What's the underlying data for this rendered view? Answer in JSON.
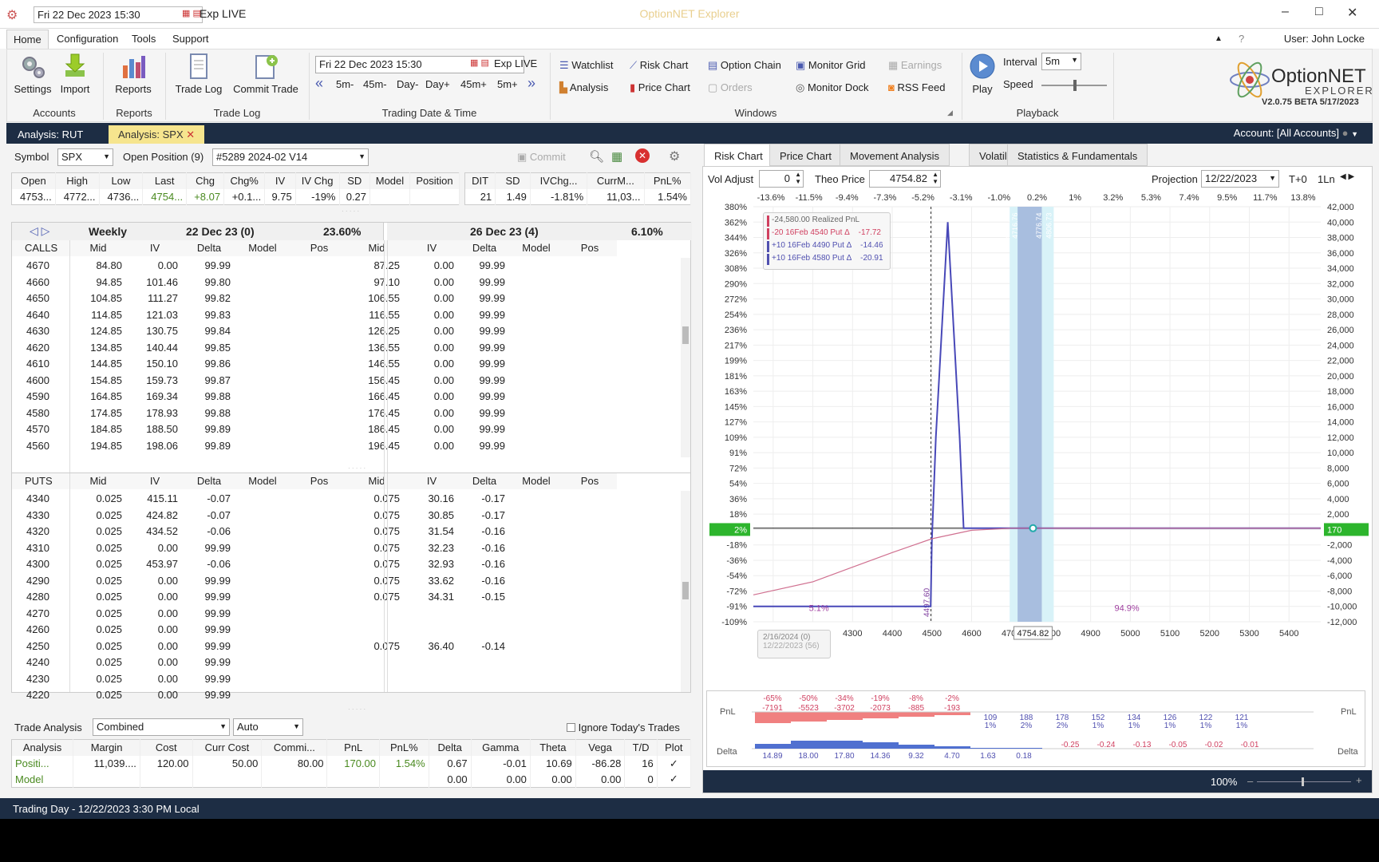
{
  "titlebar": {
    "datetime": "Fri 22 Dec 2023 15:30",
    "exp": "Exp LIVE",
    "app_title": "OptionNET Explorer"
  },
  "menu": {
    "home": "Home",
    "configuration": "Configuration",
    "tools": "Tools",
    "support": "Support",
    "user": "User: John Locke"
  },
  "ribbon": {
    "settings": "Settings",
    "import": "Import",
    "reports": "Reports",
    "trade_log": "Trade Log",
    "commit_trade": "Commit Trade",
    "groups": {
      "accounts": "Accounts",
      "reports": "Reports",
      "trade_log": "Trade Log",
      "trading_date": "Trading Date & Time",
      "windows": "Windows",
      "playback": "Playback"
    },
    "date": "Fri 22 Dec 2023 15:30",
    "exp": "Exp LIVE",
    "steps": [
      "5m-",
      "45m-",
      "Day-",
      "Day+",
      "45m+",
      "5m+"
    ],
    "windows": {
      "watchlist": "Watchlist",
      "risk_chart": "Risk Chart",
      "option_chain": "Option Chain",
      "monitor_grid": "Monitor Grid",
      "earnings": "Earnings",
      "analysis": "Analysis",
      "price_chart": "Price Chart",
      "orders": "Orders",
      "monitor_dock": "Monitor Dock",
      "rss_feed": "RSS Feed"
    },
    "play": "Play",
    "interval_label": "Interval",
    "interval_value": "5m",
    "speed_label": "Speed",
    "logo_line1": "OptionNET",
    "logo_line2": "EXPLORER",
    "version": "V2.0.75 BETA 5/17/2023"
  },
  "doc_tabs": {
    "rut": "Analysis: RUT",
    "spx": "Analysis: SPX",
    "account": "Account: [All Accounts]"
  },
  "left": {
    "symbol_label": "Symbol",
    "symbol": "SPX",
    "open_pos_label": "Open Position (9)",
    "position": "#5289 2024-02 V14",
    "commit": "Commit",
    "quote_headers": [
      "Open",
      "High",
      "Low",
      "Last",
      "Chg",
      "Chg%",
      "IV",
      "IV Chg",
      "SD",
      "Model",
      "Position"
    ],
    "quote_values": [
      "4753...",
      "4772...",
      "4736...",
      "4754...",
      "+8.07",
      "+0.1...",
      "9.75",
      "-19%",
      "0.27",
      "",
      ""
    ],
    "stat_headers": [
      "DIT",
      "SD",
      "IVChg...",
      "CurrM...",
      "PnL%"
    ],
    "stat_values": [
      "21",
      "1.49",
      "-1.81%",
      "11,03...",
      "1.54%"
    ],
    "exp1": {
      "name": "Weekly",
      "date": "22 Dec 23 (0)",
      "iv": "23.60%"
    },
    "exp2": {
      "date": "26 Dec 23 (4)",
      "iv": "6.10%"
    },
    "calls_cols": [
      "CALLS",
      "Mid",
      "IV",
      "Delta",
      "Model",
      "Pos",
      "Mid",
      "IV",
      "Delta",
      "Model",
      "Pos"
    ],
    "puts_cols": [
      "PUTS",
      "Mid",
      "IV",
      "Delta",
      "Model",
      "Pos",
      "Mid",
      "IV",
      "Delta",
      "Model",
      "Pos"
    ],
    "calls": [
      [
        "4670",
        "84.80",
        "0.00",
        "99.99",
        "87.25",
        "0.00",
        "99.99"
      ],
      [
        "4660",
        "94.85",
        "101.46",
        "99.80",
        "97.10",
        "0.00",
        "99.99"
      ],
      [
        "4650",
        "104.85",
        "111.27",
        "99.82",
        "106.55",
        "0.00",
        "99.99"
      ],
      [
        "4640",
        "114.85",
        "121.03",
        "99.83",
        "116.55",
        "0.00",
        "99.99"
      ],
      [
        "4630",
        "124.85",
        "130.75",
        "99.84",
        "126.25",
        "0.00",
        "99.99"
      ],
      [
        "4620",
        "134.85",
        "140.44",
        "99.85",
        "136.55",
        "0.00",
        "99.99"
      ],
      [
        "4610",
        "144.85",
        "150.10",
        "99.86",
        "146.55",
        "0.00",
        "99.99"
      ],
      [
        "4600",
        "154.85",
        "159.73",
        "99.87",
        "156.45",
        "0.00",
        "99.99"
      ],
      [
        "4590",
        "164.85",
        "169.34",
        "99.88",
        "166.45",
        "0.00",
        "99.99"
      ],
      [
        "4580",
        "174.85",
        "178.93",
        "99.88",
        "176.45",
        "0.00",
        "99.99"
      ],
      [
        "4570",
        "184.85",
        "188.50",
        "99.89",
        "186.45",
        "0.00",
        "99.99"
      ],
      [
        "4560",
        "194.85",
        "198.06",
        "99.89",
        "196.45",
        "0.00",
        "99.99"
      ]
    ],
    "puts": [
      [
        "4340",
        "0.025",
        "415.11",
        "-0.07",
        "0.075",
        "30.16",
        "-0.17"
      ],
      [
        "4330",
        "0.025",
        "424.82",
        "-0.07",
        "0.075",
        "30.85",
        "-0.17"
      ],
      [
        "4320",
        "0.025",
        "434.52",
        "-0.06",
        "0.075",
        "31.54",
        "-0.16"
      ],
      [
        "4310",
        "0.025",
        "0.00",
        "99.99",
        "0.075",
        "32.23",
        "-0.16"
      ],
      [
        "4300",
        "0.025",
        "453.97",
        "-0.06",
        "0.075",
        "32.93",
        "-0.16"
      ],
      [
        "4290",
        "0.025",
        "0.00",
        "99.99",
        "0.075",
        "33.62",
        "-0.16"
      ],
      [
        "4280",
        "0.025",
        "0.00",
        "99.99",
        "0.075",
        "34.31",
        "-0.15"
      ],
      [
        "4270",
        "0.025",
        "0.00",
        "99.99",
        "",
        "",
        ""
      ],
      [
        "4260",
        "0.025",
        "0.00",
        "99.99",
        "",
        "",
        ""
      ],
      [
        "4250",
        "0.025",
        "0.00",
        "99.99",
        "0.075",
        "36.40",
        "-0.14"
      ],
      [
        "4240",
        "0.025",
        "0.00",
        "99.99",
        "",
        "",
        ""
      ],
      [
        "4230",
        "0.025",
        "0.00",
        "99.99",
        "",
        "",
        ""
      ],
      [
        "4220",
        "0.025",
        "0.00",
        "99.99",
        "",
        "",
        ""
      ]
    ],
    "trade_analysis": {
      "label": "Trade Analysis",
      "mode": "Combined",
      "auto": "Auto",
      "ignore": "Ignore Today's Trades",
      "headers": [
        "Analysis",
        "Margin",
        "Cost",
        "Curr Cost",
        "Commi...",
        "PnL",
        "PnL%",
        "Delta",
        "Gamma",
        "Theta",
        "Vega",
        "T/D",
        "Plot"
      ],
      "rows": [
        [
          "Positi...",
          "11,039....",
          "120.00",
          "50.00",
          "80.00",
          "170.00",
          "1.54%",
          "0.67",
          "-0.01",
          "10.69",
          "-86.28",
          "16",
          "✓"
        ],
        [
          "Model",
          "",
          "",
          "",
          "",
          "",
          "",
          "0.00",
          "0.00",
          "0.00",
          "0.00",
          "0",
          "✓"
        ]
      ]
    }
  },
  "right": {
    "tabs": [
      "Risk Chart",
      "Price Chart",
      "Movement Analysis",
      "Volatility",
      "Statistics & Fundamentals"
    ],
    "vol_label": "Vol Adjust",
    "vol_value": "0",
    "theo_label": "Theo Price",
    "theo_value": "4754.82",
    "proj_label": "Projection",
    "proj_value": "12/22/2023",
    "tplus": "T+0",
    "ln": "1Ln",
    "top_pct": [
      "-13.6%",
      "-11.5%",
      "-9.4%",
      "-7.3%",
      "-5.2%",
      "-3.1%",
      "-1.0%",
      "0.2%",
      "1%",
      "3.2%",
      "5.3%",
      "7.4%",
      "9.5%",
      "11.7%",
      "13.8%"
    ],
    "left_axis": [
      "380%",
      "362%",
      "344%",
      "326%",
      "308%",
      "290%",
      "272%",
      "254%",
      "236%",
      "217%",
      "199%",
      "181%",
      "163%",
      "145%",
      "127%",
      "109%",
      "91%",
      "72%",
      "54%",
      "36%",
      "18%",
      "2%",
      "-18%",
      "-36%",
      "-54%",
      "-72%",
      "-91%",
      "-109%"
    ],
    "right_axis": [
      "42,000",
      "40,000",
      "38,000",
      "36,000",
      "34,000",
      "32,000",
      "30,000",
      "28,000",
      "26,000",
      "24,000",
      "22,000",
      "20,000",
      "18,000",
      "16,000",
      "14,000",
      "12,000",
      "10,000",
      "8,000",
      "6,000",
      "4,000",
      "2,000",
      "170",
      "-2,000",
      "-4,000",
      "-6,000",
      "-8,000",
      "-10,000",
      "-12,000"
    ],
    "x_axis": [
      "4100",
      "4200",
      "4300",
      "4400",
      "4500",
      "4600",
      "4700",
      "4800",
      "4900",
      "5000",
      "5100",
      "5200",
      "5300",
      "5400"
    ],
    "price_marker": "4754.82",
    "legend": [
      {
        "text": "-24,580.00 Realized PnL",
        "color": "#d04060"
      },
      {
        "text": "-20 16Feb 4540 Put Δ",
        "val": "-17.72",
        "color": "#d04060"
      },
      {
        "text": "+10 16Feb 4490 Put Δ",
        "val": "-14.46",
        "color": "#5050b0"
      },
      {
        "text": "+10 16Feb 4580 Put Δ",
        "val": "-20.91",
        "color": "#5050b0"
      }
    ],
    "date_box": [
      "2/16/2024 (0)",
      "12/22/2023 (56)"
    ],
    "prob_left": "5.1%",
    "prob_right": "94.9%",
    "vline_label": "4497.60",
    "vstrip_labels": [
      "4696.77",
      "4716.76",
      "4776.74",
      "4806.73"
    ],
    "pnl_label": "PnL",
    "delta_label": "Delta",
    "pnl_pct": [
      "-65%",
      "-50%",
      "-34%",
      "-19%",
      "-8%",
      "-2%"
    ],
    "pnl_vals": [
      "-7191",
      "-5523",
      "-3702",
      "-2073",
      "-885",
      "-193"
    ],
    "pnl_pos": [
      [
        "109",
        "1%"
      ],
      [
        "188",
        "2%"
      ],
      [
        "178",
        "2%"
      ],
      [
        "152",
        "1%"
      ],
      [
        "134",
        "1%"
      ],
      [
        "126",
        "1%"
      ],
      [
        "122",
        "1%"
      ],
      [
        "121",
        "1%"
      ]
    ],
    "delta_pos": [
      "14.89",
      "18.00",
      "17.80",
      "14.36",
      "9.32",
      "4.70",
      "1.63",
      "0.18"
    ],
    "delta_neg": [
      "-0.25",
      "-0.24",
      "-0.13",
      "-0.05",
      "-0.02",
      "-0.01"
    ],
    "zoom": "100%"
  },
  "status": {
    "text": "Trading Day - 12/22/2023 3:30 PM Local"
  },
  "chart_data": {
    "type": "line",
    "title": "",
    "xlabel": "",
    "ylabel": "",
    "xlim": [
      4050,
      5480
    ],
    "ylim": [
      -12000,
      42000
    ],
    "series": [
      {
        "name": "2/16/2024 (0)",
        "color": "#4848b8",
        "x": [
          4050,
          4497,
          4500,
          4510,
          4540,
          4570,
          4580,
          4600,
          4700,
          4800,
          5000,
          5480
        ],
        "y": [
          -10000,
          -10000,
          -1500,
          12000,
          40000,
          12000,
          170,
          170,
          170,
          170,
          170,
          170
        ]
      },
      {
        "name": "12/22/2023 (56)",
        "color": "#d07090",
        "x": [
          4050,
          4200,
          4300,
          4400,
          4500,
          4600,
          4700,
          4800,
          5000,
          5480
        ],
        "y": [
          -8500,
          -6800,
          -4900,
          -3000,
          -1200,
          -100,
          170,
          170,
          170,
          170
        ]
      }
    ]
  }
}
